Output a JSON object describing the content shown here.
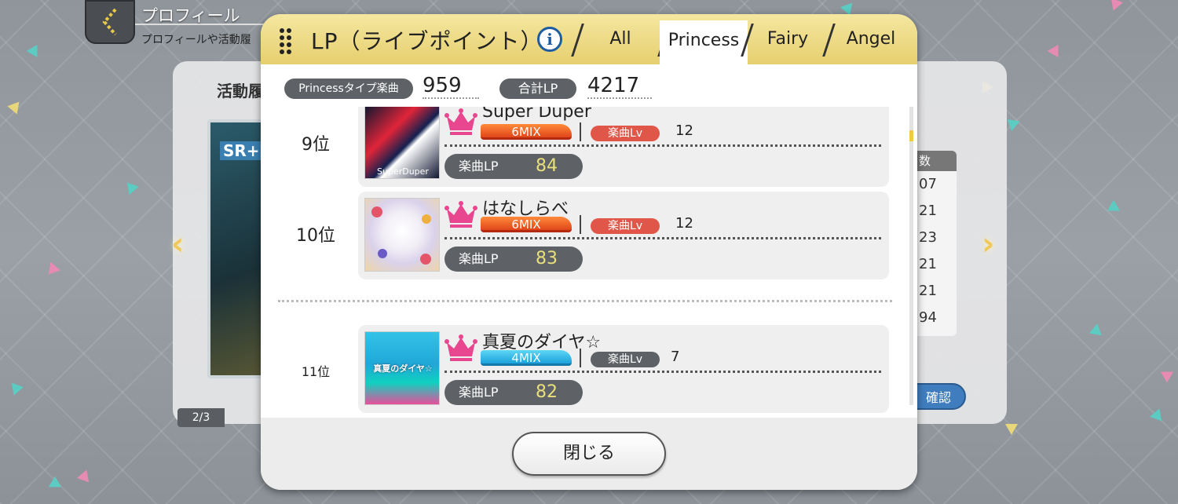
{
  "header": {
    "title": "プロフィール",
    "subtitle": "プロフィールや活動履"
  },
  "background": {
    "activity_label": "活動履",
    "card_rarity": "SR+",
    "pager": "2/3",
    "table_header": "数",
    "table_values": [
      "07",
      "21",
      "23",
      "21",
      "21",
      "94"
    ],
    "confirm_label": "確認"
  },
  "modal": {
    "title": "LP（ライブポイント）",
    "info_icon": "i",
    "tabs": [
      {
        "label": "All",
        "active": false
      },
      {
        "label": "Princess",
        "active": true
      },
      {
        "label": "Fairy",
        "active": false
      },
      {
        "label": "Angel",
        "active": false
      }
    ],
    "stats": {
      "type_label": "Princessタイプ楽曲",
      "type_value": "959",
      "total_label": "合計LP",
      "total_value": "4217"
    },
    "songs": [
      {
        "rank": "9位",
        "name": "Super Duper",
        "mix": "6MIX",
        "lv_label": "楽曲Lv",
        "lv": "12",
        "lp_label": "楽曲LP",
        "lp": "84",
        "jacket_text": "SuperDuper"
      },
      {
        "rank": "10位",
        "name": "はなしらべ",
        "mix": "6MIX",
        "lv_label": "楽曲Lv",
        "lv": "12",
        "lp_label": "楽曲LP",
        "lp": "83",
        "jacket_text": ""
      },
      {
        "rank": "11位",
        "name": "真夏のダイヤ☆",
        "mix": "4MIX",
        "lv_label": "楽曲Lv",
        "lv": "7",
        "lp_label": "楽曲LP",
        "lp": "82",
        "jacket_text": "真夏のダイヤ☆"
      }
    ],
    "close_label": "閉じる"
  },
  "colors": {
    "header_gold": "#e6cf6e",
    "mix_orange": "#e0461a",
    "mix_blue": "#1ba2dc",
    "crown_pink": "#e8468f",
    "lp_value": "#e8e07a"
  }
}
